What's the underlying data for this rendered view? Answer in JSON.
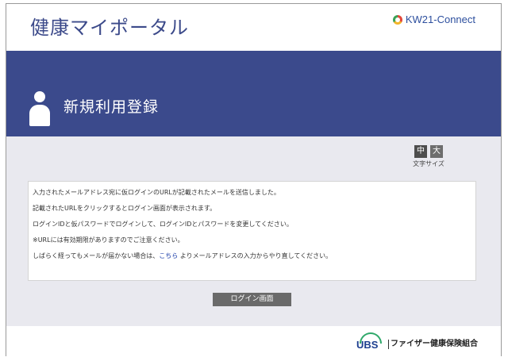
{
  "header": {
    "site_title": "健康マイポータル",
    "brand": "KW21-Connect",
    "brand_icon": "ring-logo-icon"
  },
  "banner": {
    "page_title": "新規利用登録",
    "icon": "person-icon"
  },
  "font_size": {
    "medium_label": "中",
    "large_label": "大",
    "caption": "文字サイズ"
  },
  "message": {
    "lines": [
      "入力されたメールアドレス宛に仮ログインのURLが記載されたメールを送信しました。",
      "記載されたURLをクリックするとログイン画面が表示されます。",
      "ログインIDと仮パスワードでログインして、ログインIDとパスワードを変更してください。",
      "※URLには有効期限がありますのでご注意ください。"
    ],
    "last_line_before": "しばらく経ってもメールが届かない場合は、",
    "link_text": "こちら",
    "last_line_after": " よりメールアドレスの入力からやり直してください。"
  },
  "actions": {
    "login_button": "ログイン画面"
  },
  "footer": {
    "logo_text": "UBS",
    "org_name": "ファイザー健康保険組合"
  },
  "colors": {
    "banner": "#3b4a8c",
    "title": "#3c4a8a",
    "background": "#e9e9ef",
    "button": "#6a6a6a",
    "link": "#1a3ca8"
  }
}
